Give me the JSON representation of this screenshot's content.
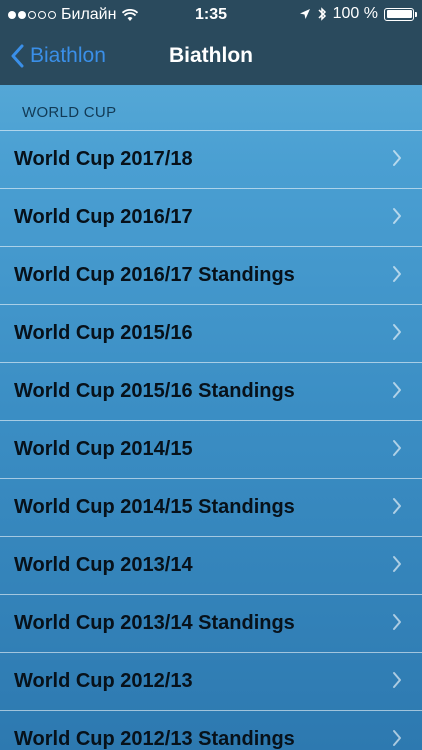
{
  "status_bar": {
    "carrier": "Билайн",
    "time": "1:35",
    "battery": "100 %"
  },
  "nav": {
    "back_label": "Biathlon",
    "title": "Biathlon"
  },
  "section": {
    "header": "WORLD CUP"
  },
  "items": [
    {
      "label": "World Cup 2017/18"
    },
    {
      "label": "World Cup 2016/17"
    },
    {
      "label": "World Cup 2016/17 Standings"
    },
    {
      "label": "World Cup 2015/16"
    },
    {
      "label": "World Cup 2015/16 Standings"
    },
    {
      "label": "World Cup 2014/15"
    },
    {
      "label": "World Cup 2014/15 Standings"
    },
    {
      "label": "World Cup 2013/14"
    },
    {
      "label": "World Cup 2013/14 Standings"
    },
    {
      "label": "World Cup 2012/13"
    },
    {
      "label": "World Cup 2012/13 Standings"
    }
  ],
  "colors": {
    "bar": "#2a4a5d",
    "accent": "#3a8fe8"
  }
}
